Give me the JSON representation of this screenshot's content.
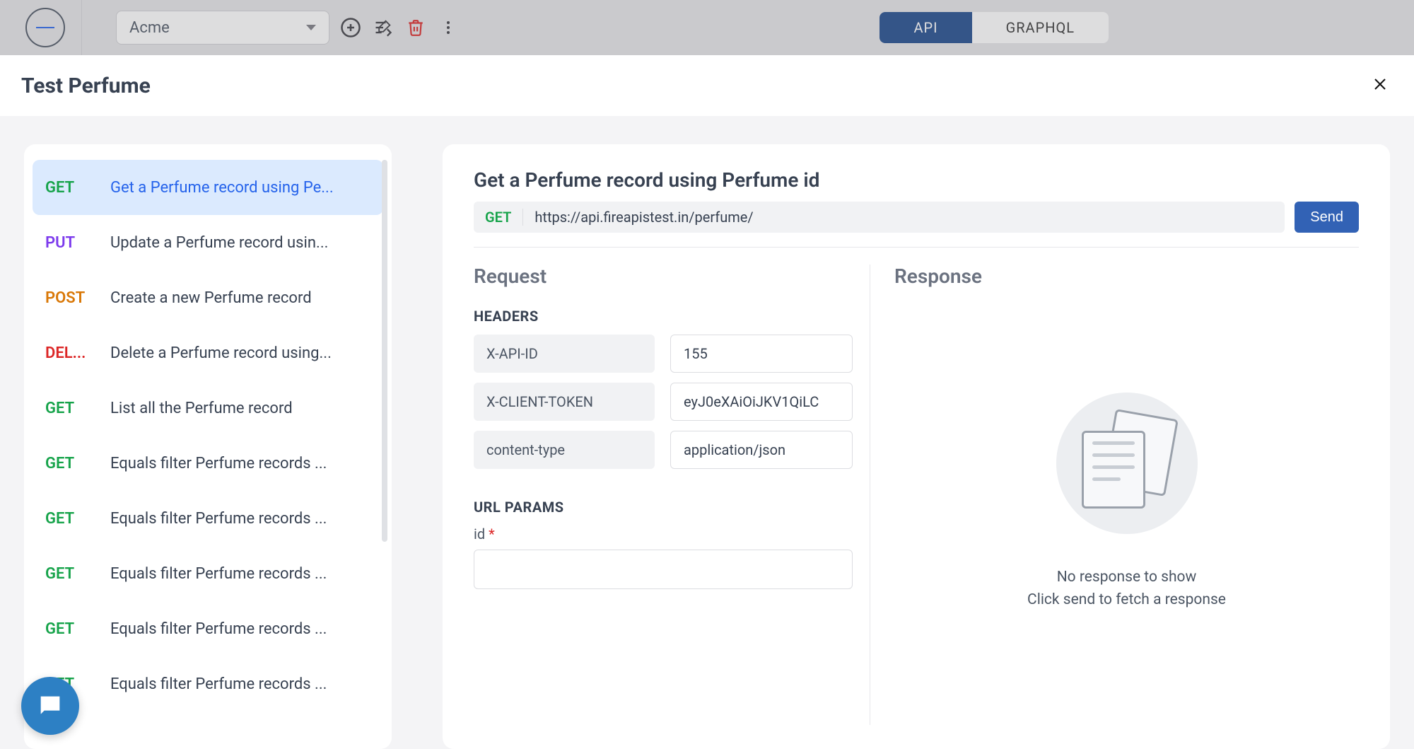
{
  "topbar": {
    "workspace": "Acme",
    "tabs": {
      "api": "API",
      "graphql": "GRAPHQL"
    }
  },
  "modal": {
    "title": "Test Perfume"
  },
  "endpoints": [
    {
      "method": "GET",
      "label": "Get a Perfume record using Pe...",
      "selected": true
    },
    {
      "method": "PUT",
      "label": "Update a Perfume record usin..."
    },
    {
      "method": "POST",
      "label": "Create a new Perfume record"
    },
    {
      "method": "DELETE",
      "display_method": "DEL...",
      "label": "Delete a Perfume record using..."
    },
    {
      "method": "GET",
      "label": "List all the Perfume record"
    },
    {
      "method": "GET",
      "label": "Equals filter Perfume records ..."
    },
    {
      "method": "GET",
      "label": "Equals filter Perfume records ..."
    },
    {
      "method": "GET",
      "label": "Equals filter Perfume records ..."
    },
    {
      "method": "GET",
      "label": "Equals filter Perfume records ..."
    },
    {
      "method": "GET",
      "label": "Equals filter Perfume records ..."
    }
  ],
  "detail": {
    "title": "Get a Perfume record using Perfume id",
    "method": "GET",
    "url": "https://api.fireapistest.in/perfume/",
    "send": "Send",
    "request_heading": "Request",
    "response_heading": "Response",
    "headers_heading": "HEADERS",
    "url_params_heading": "URL PARAMS",
    "headers": [
      {
        "key": "X-API-ID",
        "value": "155"
      },
      {
        "key": "X-CLIENT-TOKEN",
        "value": "eyJ0eXAiOiJKV1QiLC"
      },
      {
        "key": "content-type",
        "value": "application/json"
      }
    ],
    "url_params": [
      {
        "name": "id",
        "required": true,
        "value": ""
      }
    ],
    "empty": {
      "line1": "No response to show",
      "line2": "Click send to fetch a response"
    }
  }
}
